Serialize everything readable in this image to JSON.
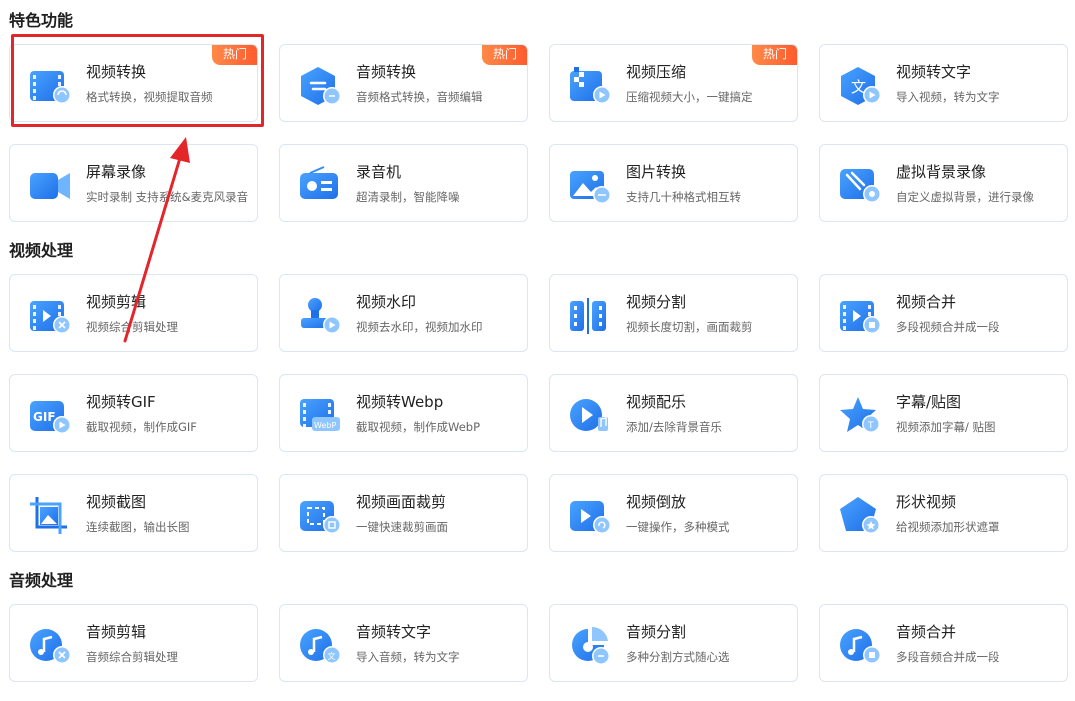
{
  "sections": [
    {
      "title": "特色功能"
    },
    {
      "title": "视频处理"
    },
    {
      "title": "音频处理"
    }
  ],
  "featured": [
    {
      "title": "视频转换",
      "desc": "格式转换，视频提取音频",
      "badge": "热门",
      "icon": "video-convert-icon"
    },
    {
      "title": "音频转换",
      "desc": "音频格式转换，音频编辑",
      "badge": "热门",
      "icon": "audio-convert-icon"
    },
    {
      "title": "视频压缩",
      "desc": "压缩视频大小，一键搞定",
      "badge": "热门",
      "icon": "video-compress-icon"
    },
    {
      "title": "视频转文字",
      "desc": "导入视频，转为文字",
      "icon": "video-to-text-icon"
    },
    {
      "title": "屏幕录像",
      "desc": "实时录制 支持系统&麦克风录音",
      "icon": "screen-record-icon"
    },
    {
      "title": "录音机",
      "desc": "超清录制，智能降噪",
      "icon": "recorder-icon"
    },
    {
      "title": "图片转换",
      "desc": "支持几十种格式相互转",
      "icon": "image-convert-icon"
    },
    {
      "title": "虚拟背景录像",
      "desc": "自定义虚拟背景，进行录像",
      "icon": "virtual-bg-icon"
    }
  ],
  "video": [
    {
      "title": "视频剪辑",
      "desc": "视频综合剪辑处理",
      "icon": "video-edit-icon"
    },
    {
      "title": "视频水印",
      "desc": "视频去水印，视频加水印",
      "icon": "video-watermark-icon"
    },
    {
      "title": "视频分割",
      "desc": "视频长度切割，画面裁剪",
      "icon": "video-split-icon"
    },
    {
      "title": "视频合并",
      "desc": "多段视频合并成一段",
      "icon": "video-merge-icon"
    },
    {
      "title": "视频转GIF",
      "desc": "截取视频，制作成GIF",
      "icon": "video-to-gif-icon"
    },
    {
      "title": "视频转Webp",
      "desc": "截取视频，制作成WebP",
      "icon": "video-to-webp-icon"
    },
    {
      "title": "视频配乐",
      "desc": "添加/去除背景音乐",
      "icon": "video-music-icon"
    },
    {
      "title": "字幕/贴图",
      "desc": "视频添加字幕/ 贴图",
      "icon": "subtitle-sticker-icon"
    },
    {
      "title": "视频截图",
      "desc": "连续截图，输出长图",
      "icon": "video-screenshot-icon"
    },
    {
      "title": "视频画面裁剪",
      "desc": "一键快速裁剪画面",
      "icon": "video-crop-icon"
    },
    {
      "title": "视频倒放",
      "desc": "一键操作，多种模式",
      "icon": "video-reverse-icon"
    },
    {
      "title": "形状视频",
      "desc": "给视频添加形状遮罩",
      "icon": "shape-video-icon"
    }
  ],
  "audio": [
    {
      "title": "音频剪辑",
      "desc": "音频综合剪辑处理",
      "icon": "audio-edit-icon"
    },
    {
      "title": "音频转文字",
      "desc": "导入音频，转为文字",
      "icon": "audio-to-text-icon"
    },
    {
      "title": "音频分割",
      "desc": "多种分割方式随心选",
      "icon": "audio-split-icon"
    },
    {
      "title": "音频合并",
      "desc": "多段音频合并成一段",
      "icon": "audio-merge-icon"
    }
  ],
  "colors": {
    "accent": "#2b7cf3",
    "badge": "#ff6a3a",
    "highlight": "#e3262a"
  }
}
